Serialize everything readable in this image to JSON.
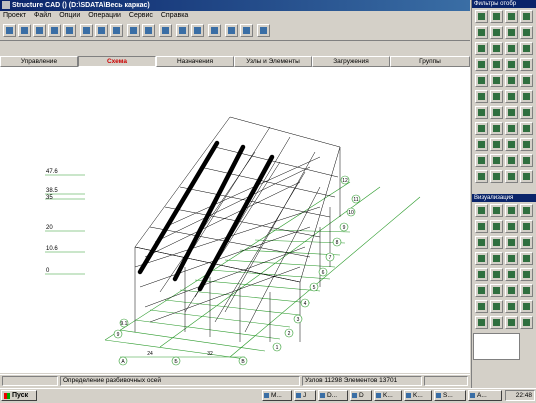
{
  "window": {
    "title": "Structure CAD () (D:\\SDATA\\Весь каркас)"
  },
  "menu": [
    "Проект",
    "Файл",
    "Опции",
    "Операции",
    "Сервис",
    "Справка"
  ],
  "tabs": [
    {
      "label": "Управление"
    },
    {
      "label": "Схема"
    },
    {
      "label": "Назначения"
    },
    {
      "label": "Узлы и Элементы"
    },
    {
      "label": "Загружения"
    },
    {
      "label": "Группы"
    }
  ],
  "right_panel": {
    "filter_title": "Фильтры отобр",
    "viz_title": "Визуализация"
  },
  "levels": [
    "47.6",
    "38.5",
    "35",
    "20",
    "10.6",
    "0"
  ],
  "axis_rows": [
    "1",
    "2",
    "3",
    "4",
    "5",
    "6",
    "7",
    "8",
    "9",
    "10",
    "11",
    "12"
  ],
  "axis_cols": [
    "A",
    "Б",
    "В"
  ],
  "dims": [
    "24",
    "32"
  ],
  "side_axis": [
    "9",
    "9.1"
  ],
  "status": {
    "left": "Определение разбивочных осей",
    "right": "Узлов 11298 Элементов 13701"
  },
  "taskbar": {
    "start": "Пуск",
    "items": [
      "M...",
      "J",
      "D...",
      "D",
      "K...",
      "K...",
      "S...",
      "A..."
    ],
    "clock": "22:48"
  }
}
